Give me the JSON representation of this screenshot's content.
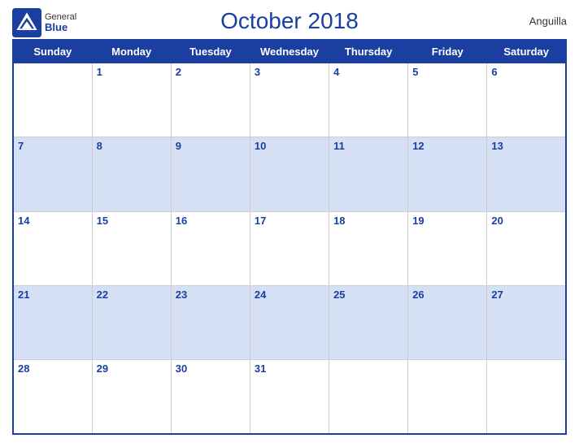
{
  "header": {
    "title": "October 2018",
    "country": "Anguilla",
    "logo": {
      "general": "General",
      "blue": "Blue"
    }
  },
  "days": [
    "Sunday",
    "Monday",
    "Tuesday",
    "Wednesday",
    "Thursday",
    "Friday",
    "Saturday"
  ],
  "weeks": [
    [
      null,
      1,
      2,
      3,
      4,
      5,
      6
    ],
    [
      7,
      8,
      9,
      10,
      11,
      12,
      13
    ],
    [
      14,
      15,
      16,
      17,
      18,
      19,
      20
    ],
    [
      21,
      22,
      23,
      24,
      25,
      26,
      27
    ],
    [
      28,
      29,
      30,
      31,
      null,
      null,
      null
    ]
  ]
}
